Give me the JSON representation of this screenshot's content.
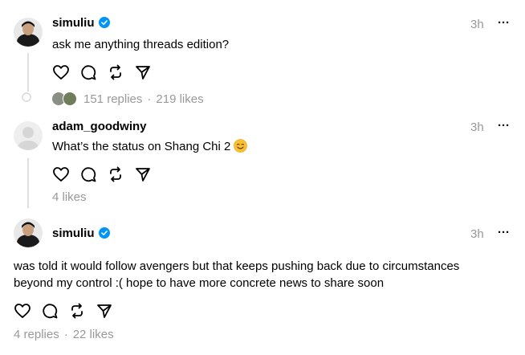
{
  "posts": [
    {
      "username": "simuliu",
      "verified": true,
      "time": "3h",
      "text": "ask me anything threads edition?",
      "replies": "151 replies",
      "likes": "219 likes"
    },
    {
      "username": "adam_goodwiny",
      "verified": false,
      "time": "3h",
      "text": "What’s the status on Shang Chi 2",
      "emoji": "smiling-face-emoji",
      "likes": "4 likes"
    },
    {
      "username": "simuliu",
      "verified": true,
      "time": "3h",
      "text_line1": "was told it would follow avengers but that keeps pushing back due to circumstances",
      "text_line2": "beyond my control :( hope to have more concrete news to share soon",
      "replies": "4 replies",
      "likes": "22 likes"
    }
  ],
  "more_label": "···",
  "separator": "·",
  "icons": [
    "heart-icon",
    "comment-icon",
    "repost-icon",
    "share-icon",
    "verified-badge-icon",
    "more-icon"
  ],
  "colors": {
    "verified": "#0095f6",
    "muted": "#999999",
    "thread_line": "#e0e0e0"
  }
}
